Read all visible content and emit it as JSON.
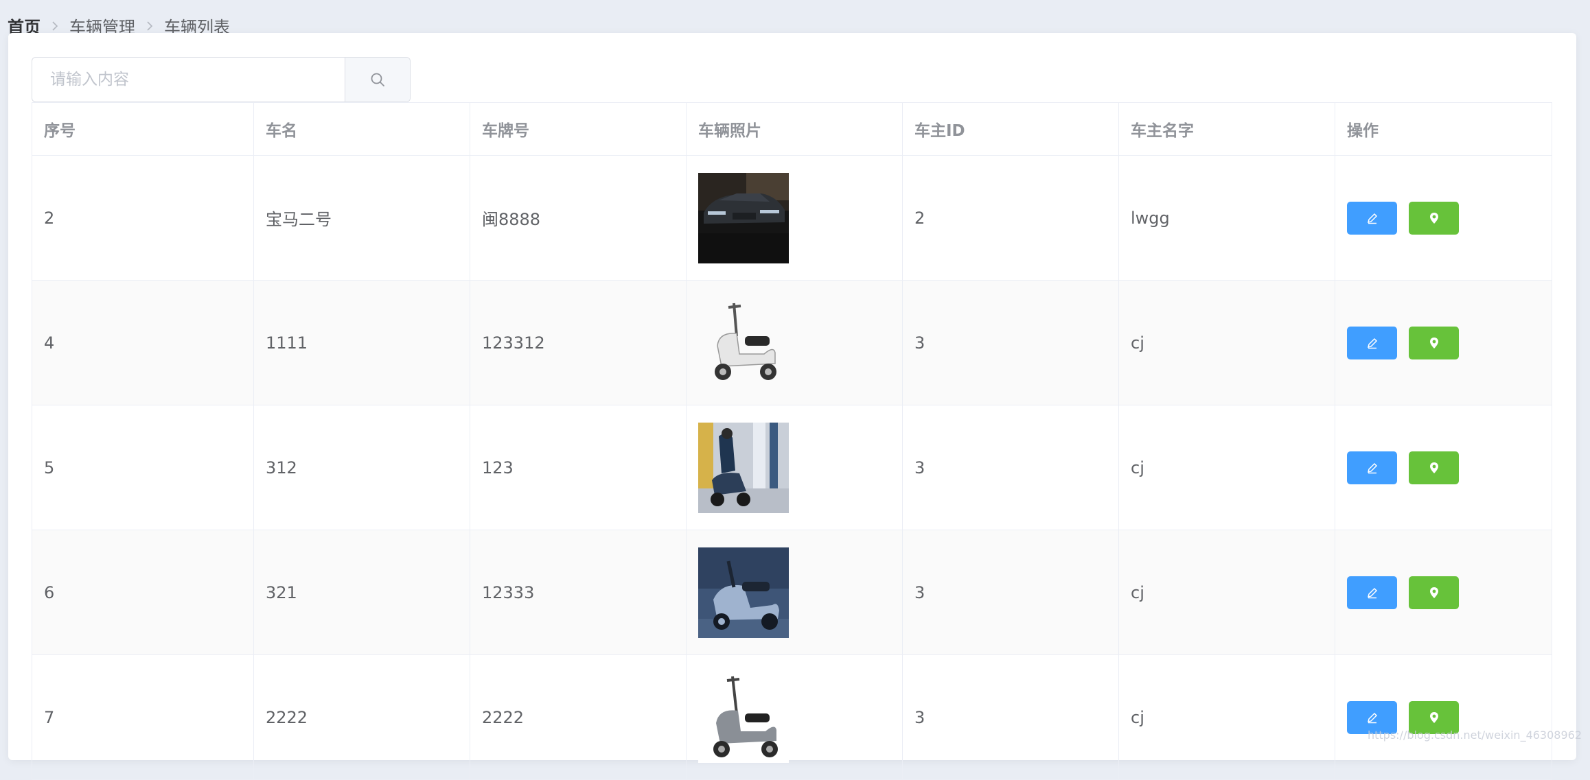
{
  "breadcrumb": {
    "home": "首页",
    "items": [
      "车辆管理",
      "车辆列表"
    ]
  },
  "search": {
    "placeholder": "请输入内容",
    "icon": "search-icon"
  },
  "table": {
    "headers": [
      "序号",
      "车名",
      "车牌号",
      "车辆照片",
      "车主ID",
      "车主名字",
      "操作"
    ],
    "rows": [
      {
        "id": "2",
        "name": "宝马二号",
        "plate": "闽8888",
        "photo": "black-car-photo",
        "owner_id": "2",
        "owner_name": "lwgg"
      },
      {
        "id": "4",
        "name": "1111",
        "plate": "123312",
        "photo": "white-scooter-photo",
        "owner_id": "3",
        "owner_name": "cj"
      },
      {
        "id": "5",
        "name": "312",
        "plate": "123",
        "photo": "rider-scooter-photo",
        "owner_id": "3",
        "owner_name": "cj"
      },
      {
        "id": "6",
        "name": "321",
        "plate": "12333",
        "photo": "blue-scooter-photo",
        "owner_id": "3",
        "owner_name": "cj"
      },
      {
        "id": "7",
        "name": "2222",
        "plate": "2222",
        "photo": "grey-scooter-photo",
        "owner_id": "3",
        "owner_name": "cj"
      }
    ],
    "actions": {
      "edit_icon": "edit-icon",
      "location_icon": "location-pin-icon"
    }
  },
  "colors": {
    "primary": "#409eff",
    "success": "#67c23a",
    "page_bg": "#e9edf4"
  },
  "watermark": "https://blog.csdn.net/weixin_46308962"
}
